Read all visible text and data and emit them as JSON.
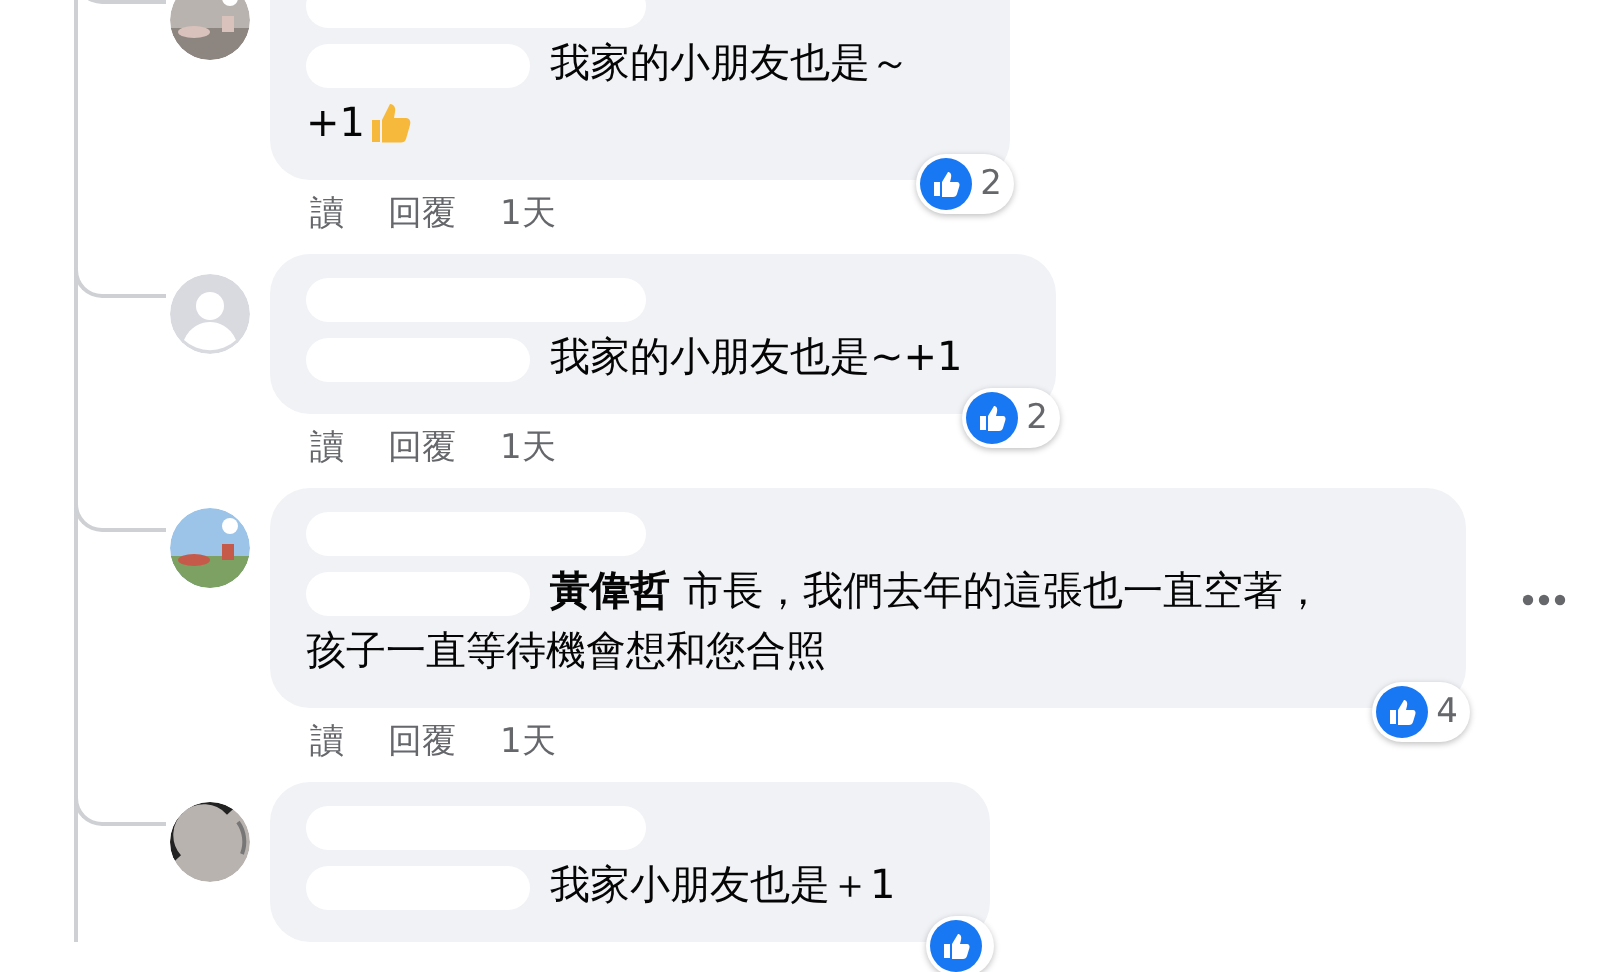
{
  "comments": [
    {
      "avatar": {
        "kind": "picture"
      },
      "name_hidden": true,
      "body": "我家的小朋友也是～",
      "body_line_2": "+1",
      "thumb_emoji": true,
      "actions": [
        "讀",
        "回覆",
        "1天"
      ],
      "reaction": {
        "count": "2"
      },
      "show_more": false
    },
    {
      "avatar": {
        "kind": "default"
      },
      "name_hidden": true,
      "body": "我家的小朋友也是~+1",
      "actions": [
        "讀",
        "回覆",
        "1天"
      ],
      "reaction": {
        "count": "2"
      },
      "show_more": false
    },
    {
      "avatar": {
        "kind": "picture"
      },
      "name_hidden": true,
      "body": "**黃偉哲** 市長，我們去年的這張也一直空著，孩子一直等待機會想和您合照",
      "actions": [
        "讀",
        "回覆",
        "1天"
      ],
      "reaction": {
        "count": "4"
      },
      "show_more": true
    },
    {
      "avatar": {
        "kind": "picture"
      },
      "name_hidden": true,
      "body": "我家小朋友也是＋1",
      "reaction": {
        "visible": true
      },
      "show_more": false
    }
  ]
}
